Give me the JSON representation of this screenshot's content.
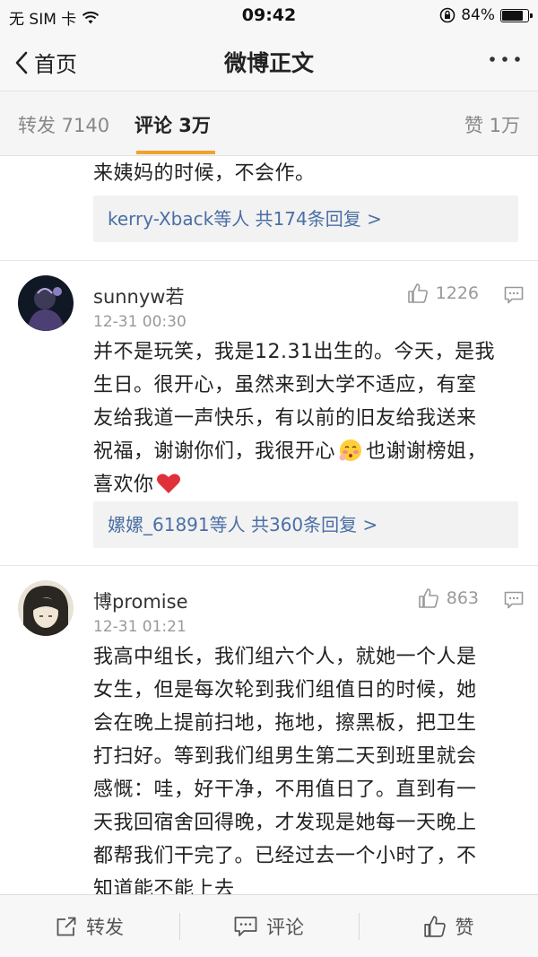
{
  "status_bar": {
    "carrier": "无 SIM 卡",
    "time": "09:42",
    "battery": "84%",
    "battery_level": 0.84
  },
  "nav": {
    "back_label": "首页",
    "title": "微博正文"
  },
  "tabs": {
    "repost": "转发 7140",
    "comment": "评论 3万",
    "like": "赞 1万"
  },
  "comments": [
    {
      "text_tail": "来姨妈的时候，不会作。",
      "replies": "kerry-Xback等人  共174条回复 >"
    },
    {
      "username": "sunnyw若",
      "time": "12-31 00:30",
      "likes": "1226",
      "lines": [
        "并不是玩笑，我是12.31出生的。今天，是我",
        "生日。很开心，虽然来到大学不适应，有室",
        "友给我道一声快乐，有以前的旧友给我送来",
        "祝福，谢谢你们，我很开心",
        "也谢谢榜姐，",
        "喜欢你"
      ],
      "replies": "嫘嫘_61891等人  共360条回复 >"
    },
    {
      "username": "博promise",
      "time": "12-31 01:21",
      "likes": "863",
      "lines": [
        "我高中组长，我们组六个人，就她一个人是",
        "女生，但是每次轮到我们组值日的时候，她",
        "会在晚上提前扫地，拖地，擦黑板，把卫生",
        "打扫好。等到我们组男生第二天到班里就会",
        "感慨：哇，好干净，不用值日了。直到有一",
        "天我回宿舍回得晚，才发现是她每一天晚上",
        "都帮我们干完了。已经过去一个小时了，不",
        "知道能不能上去"
      ]
    }
  ],
  "bottom_bar": {
    "repost": "转发",
    "comment": "评论",
    "like": "赞"
  },
  "colors": {
    "accent": "#f0a32a",
    "link": "#4a6fa5",
    "heart": "#e0303a"
  }
}
